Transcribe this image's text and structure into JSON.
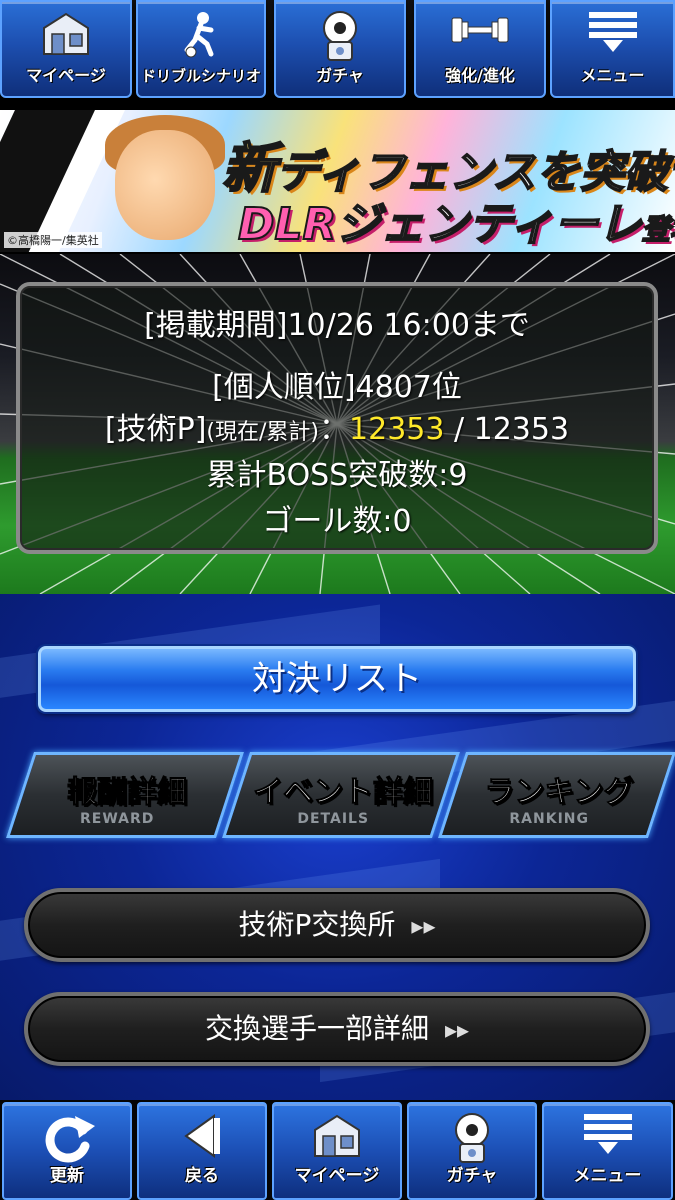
{
  "top_nav": {
    "mypage": "マイページ",
    "dribble": "ドリブルシナリオ",
    "gacha": "ガチャ",
    "enhance": "強化/進化",
    "menu": "メニュー"
  },
  "banner": {
    "line1_big": "新",
    "line1_rest": "ディフェンスを突破せよ!!",
    "line2_dlr": "DLR",
    "line2_name": "ジェンティーレ",
    "line2_suffix": "登場!!",
    "copyright": "©高橋陽一/集英社"
  },
  "info": {
    "period": "[掲載期間]10/26 16:00まで",
    "rank": "[個人順位]4807位",
    "tech_label": "[技術P]",
    "tech_sub": "(現在/累計)",
    "tech_colon": "：",
    "tech_current": "12353",
    "tech_total": " / 12353",
    "boss": "累計BOSS突破数:9",
    "goals": "ゴール数:0"
  },
  "main": {
    "vs_list": "対決リスト",
    "reward_label": "報酬詳細",
    "reward_sub": "REWARD",
    "details_label": "イベント詳細",
    "details_sub": "DETAILS",
    "ranking_label": "ランキング",
    "ranking_sub": "RANKING",
    "exchange": "技術P交換所",
    "exchange_players": "交換選手一部詳細",
    "arrow": "▸▸"
  },
  "bottom_nav": {
    "refresh": "更新",
    "back": "戻る",
    "mypage": "マイページ",
    "gacha": "ガチャ",
    "menu": "メニュー"
  }
}
